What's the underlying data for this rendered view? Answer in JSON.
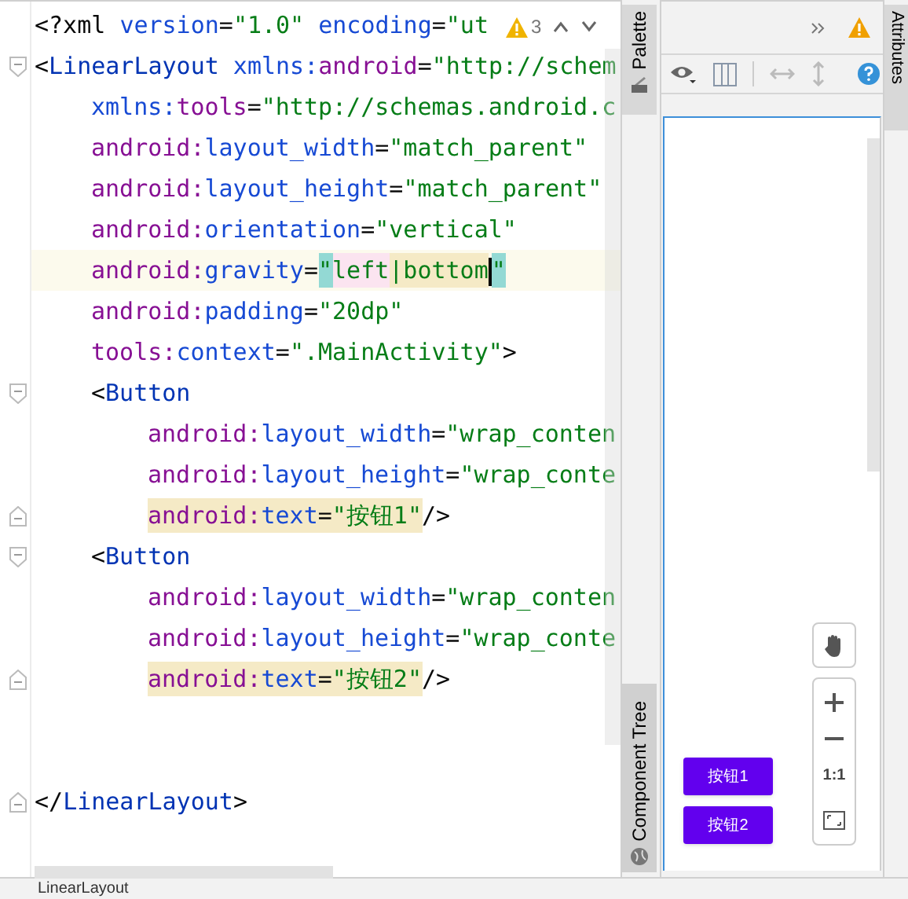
{
  "editor": {
    "warning_count": "3",
    "lines": [
      {
        "fold_start": false,
        "fold_end": false,
        "current": false,
        "segments": [
          {
            "text": "<?xml ",
            "kind": "punct"
          },
          {
            "text": "version",
            "kind": "attr"
          },
          {
            "text": "=",
            "kind": "punct"
          },
          {
            "text": "\"1.0\"",
            "kind": "value"
          },
          {
            "text": " encoding",
            "kind": "attr"
          },
          {
            "text": "=",
            "kind": "punct"
          },
          {
            "text": "\"ut",
            "kind": "value"
          }
        ]
      },
      {
        "fold_start": true,
        "fold_end": false,
        "current": false,
        "segments": [
          {
            "text": "<",
            "kind": "punct"
          },
          {
            "text": "LinearLayout",
            "kind": "tag"
          },
          {
            "text": " xmlns:",
            "kind": "attr"
          },
          {
            "text": "android",
            "kind": "ns"
          },
          {
            "text": "=",
            "kind": "punct"
          },
          {
            "text": "\"http://schem",
            "kind": "value"
          }
        ],
        "children": [
          {
            "fold_start": false,
            "fold_end": false,
            "current": false,
            "segments": [
              {
                "text": "xmlns:",
                "kind": "attr"
              },
              {
                "text": "tools",
                "kind": "ns"
              },
              {
                "text": "=",
                "kind": "punct"
              },
              {
                "text": "\"http://schemas.android.c",
                "kind": "value"
              }
            ]
          },
          {
            "fold_start": false,
            "fold_end": false,
            "current": false,
            "segments": [
              {
                "text": "android:",
                "kind": "ns"
              },
              {
                "text": "layout_width",
                "kind": "attr"
              },
              {
                "text": "=",
                "kind": "punct"
              },
              {
                "text": "\"match_parent\"",
                "kind": "value"
              }
            ]
          },
          {
            "fold_start": false,
            "fold_end": false,
            "current": false,
            "segments": [
              {
                "text": "android:",
                "kind": "ns"
              },
              {
                "text": "layout_height",
                "kind": "attr"
              },
              {
                "text": "=",
                "kind": "punct"
              },
              {
                "text": "\"match_parent\"",
                "kind": "value"
              }
            ]
          },
          {
            "fold_start": false,
            "fold_end": false,
            "current": false,
            "segments": [
              {
                "text": "android:",
                "kind": "ns"
              },
              {
                "text": "orientation",
                "kind": "attr"
              },
              {
                "text": "=",
                "kind": "punct"
              },
              {
                "text": "\"vertical\"",
                "kind": "value"
              }
            ]
          },
          {
            "fold_start": false,
            "fold_end": false,
            "current": true,
            "segments": [
              {
                "text": "android:",
                "kind": "ns"
              },
              {
                "text": "gravity",
                "kind": "attr"
              },
              {
                "text": "=",
                "kind": "punct"
              },
              {
                "text": "\"",
                "kind": "value",
                "color": "#93d9d4"
              },
              {
                "text": "left",
                "kind": "value",
                "color": "#fbe4f0"
              },
              {
                "text": "|bottom",
                "kind": "value",
                "color": "#f5eac6"
              },
              {
                "kind": "caret"
              },
              {
                "text": "\"",
                "kind": "value",
                "color": "#93d9d4"
              }
            ]
          },
          {
            "fold_start": false,
            "fold_end": false,
            "current": false,
            "segments": [
              {
                "text": "android:",
                "kind": "ns"
              },
              {
                "text": "padding",
                "kind": "attr"
              },
              {
                "text": "=",
                "kind": "punct"
              },
              {
                "text": "\"20dp\"",
                "kind": "value"
              }
            ]
          },
          {
            "fold_start": false,
            "fold_end": false,
            "current": false,
            "segments": [
              {
                "text": "tools:",
                "kind": "ns"
              },
              {
                "text": "context",
                "kind": "attr"
              },
              {
                "text": "=",
                "kind": "punct"
              },
              {
                "text": "\".MainActivity\"",
                "kind": "value"
              },
              {
                "text": ">",
                "kind": "punct"
              }
            ]
          },
          {
            "fold_start": true,
            "fold_end": false,
            "current": false,
            "segments": [
              {
                "text": "<",
                "kind": "punct"
              },
              {
                "text": "Button",
                "kind": "tag"
              }
            ],
            "children": [
              {
                "fold_start": false,
                "fold_end": false,
                "current": false,
                "segments": [
                  {
                    "text": "android:",
                    "kind": "ns"
                  },
                  {
                    "text": "layout_width",
                    "kind": "attr"
                  },
                  {
                    "text": "=",
                    "kind": "punct"
                  },
                  {
                    "text": "\"wrap_conten",
                    "kind": "value"
                  }
                ]
              },
              {
                "fold_start": false,
                "fold_end": false,
                "current": false,
                "segments": [
                  {
                    "text": "android:",
                    "kind": "ns"
                  },
                  {
                    "text": "layout_height",
                    "kind": "attr"
                  },
                  {
                    "text": "=",
                    "kind": "punct"
                  },
                  {
                    "text": "\"wrap_conte",
                    "kind": "value"
                  }
                ]
              },
              {
                "fold_start": false,
                "fold_end": true,
                "current": false,
                "segments": [
                  {
                    "text": "android:",
                    "kind": "ns",
                    "color": "#f5eac6"
                  },
                  {
                    "text": "text",
                    "kind": "attr",
                    "color": "#f5eac6"
                  },
                  {
                    "text": "=",
                    "kind": "punct",
                    "color": "#f5eac6"
                  },
                  {
                    "text": "\"按钮1\"",
                    "kind": "value",
                    "color": "#f5eac6"
                  },
                  {
                    "text": "/>",
                    "kind": "punct"
                  }
                ]
              }
            ]
          },
          {
            "fold_start": true,
            "fold_end": false,
            "current": false,
            "segments": [
              {
                "text": "<",
                "kind": "punct"
              },
              {
                "text": "Button",
                "kind": "tag"
              }
            ],
            "children": [
              {
                "fold_start": false,
                "fold_end": false,
                "current": false,
                "segments": [
                  {
                    "text": "android:",
                    "kind": "ns"
                  },
                  {
                    "text": "layout_width",
                    "kind": "attr"
                  },
                  {
                    "text": "=",
                    "kind": "punct"
                  },
                  {
                    "text": "\"wrap_conten",
                    "kind": "value"
                  }
                ]
              },
              {
                "fold_start": false,
                "fold_end": false,
                "current": false,
                "segments": [
                  {
                    "text": "android:",
                    "kind": "ns"
                  },
                  {
                    "text": "layout_height",
                    "kind": "attr"
                  },
                  {
                    "text": "=",
                    "kind": "punct"
                  },
                  {
                    "text": "\"wrap_conte",
                    "kind": "value"
                  }
                ]
              },
              {
                "fold_start": false,
                "fold_end": true,
                "current": false,
                "segments": [
                  {
                    "text": "android:",
                    "kind": "ns",
                    "color": "#f5eac6"
                  },
                  {
                    "text": "text",
                    "kind": "attr",
                    "color": "#f5eac6"
                  },
                  {
                    "text": "=",
                    "kind": "punct",
                    "color": "#f5eac6"
                  },
                  {
                    "text": "\"按钮2\"",
                    "kind": "value",
                    "color": "#f5eac6"
                  },
                  {
                    "text": "/>",
                    "kind": "punct"
                  }
                ]
              }
            ]
          }
        ]
      },
      {
        "fold_start": false,
        "fold_end": false,
        "current": false
      },
      {
        "fold_start": false,
        "fold_end": false,
        "current": false
      },
      {
        "fold_start": false,
        "fold_end": true,
        "current": false,
        "segments": [
          {
            "text": "</",
            "kind": "punct"
          },
          {
            "text": "LinearLayout",
            "kind": "tag"
          },
          {
            "text": ">",
            "kind": "punct"
          }
        ]
      }
    ]
  },
  "side_tabs": {
    "palette": "Palette",
    "component_tree": "Component Tree",
    "attributes": "Attributes"
  },
  "design": {
    "buttons": [
      {
        "text": "按钮1"
      },
      {
        "text": "按钮2"
      }
    ],
    "zoom_actual_size": "1:1"
  },
  "status_bar": {
    "breadcrumb": "LinearLayout"
  }
}
